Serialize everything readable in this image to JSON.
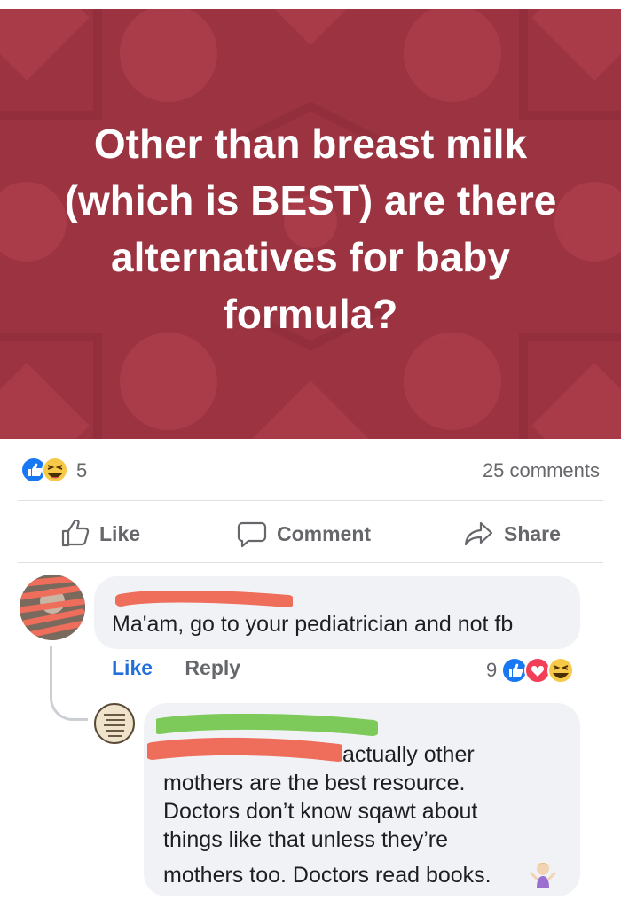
{
  "post": {
    "banner_text": "Other than breast milk (which is BEST) are there alternatives for baby formula?",
    "banner_colors": {
      "background": "#9c3341",
      "pattern": "#b5434f"
    }
  },
  "stats": {
    "reaction_icons": [
      "like-icon",
      "haha-icon"
    ],
    "reaction_count": "5",
    "comments_count": "25 comments"
  },
  "actions": {
    "like_label": "Like",
    "comment_label": "Comment",
    "share_label": "Share"
  },
  "comments": [
    {
      "author_redacted": true,
      "text": "Ma'am, go to your pediatrician and not fb",
      "like_label": "Like",
      "reply_label": "Reply",
      "reaction_count": "9",
      "reaction_icons": [
        "like-icon",
        "love-icon",
        "haha-icon"
      ]
    },
    {
      "author_redacted": true,
      "text_line_1": "actually other",
      "text_line_2": "mothers are the best resource.",
      "text_line_3": "Doctors don’t know sqawt about",
      "text_line_4": "things like that unless they’re",
      "text_line_5": "mothers too. Doctors read books.",
      "emoji": "person-shrugging-emoji"
    }
  ],
  "colors": {
    "link_blue": "#216fdb",
    "muted_gray": "#65676b",
    "bubble_bg": "#f0f2f5",
    "redact_red": "#ee6d5b",
    "redact_green": "#7dca5a"
  }
}
